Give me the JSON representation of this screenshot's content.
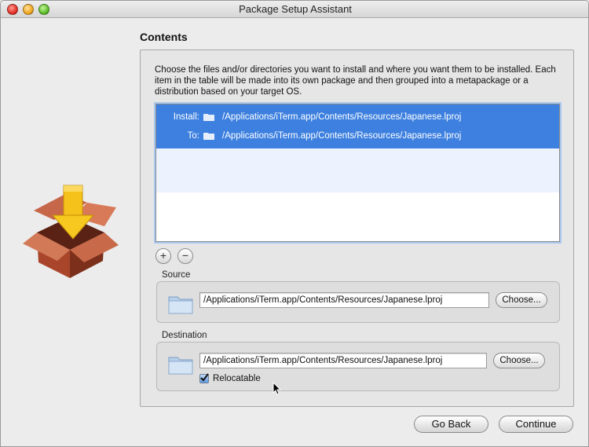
{
  "window": {
    "title": "Package Setup Assistant"
  },
  "section": {
    "heading": "Contents",
    "description": "Choose the files and/or directories you want to install and where you want them to be installed. Each item in the table will be made into its own package and then grouped into a metapackage or a distribution based on your target OS."
  },
  "table": {
    "rows": [
      {
        "install_label": "Install:",
        "install_path": "/Applications/iTerm.app/Contents/Resources/Japanese.lproj",
        "to_label": "To:",
        "to_path": "/Applications/iTerm.app/Contents/Resources/Japanese.lproj",
        "selected": true
      }
    ],
    "add_label": "+",
    "remove_label": "−"
  },
  "source": {
    "label": "Source",
    "path": "/Applications/iTerm.app/Contents/Resources/Japanese.lproj",
    "choose_label": "Choose..."
  },
  "destination": {
    "label": "Destination",
    "path": "/Applications/iTerm.app/Contents/Resources/Japanese.lproj",
    "choose_label": "Choose...",
    "relocatable_label": "Relocatable",
    "relocatable_checked": true
  },
  "footer": {
    "back_label": "Go Back",
    "continue_label": "Continue"
  },
  "colors": {
    "selection": "#3d80df",
    "alt_row": "#edf3fe"
  },
  "icons": [
    "package-icon",
    "folder-icon",
    "checkmark-icon",
    "pointer-cursor-icon"
  ]
}
